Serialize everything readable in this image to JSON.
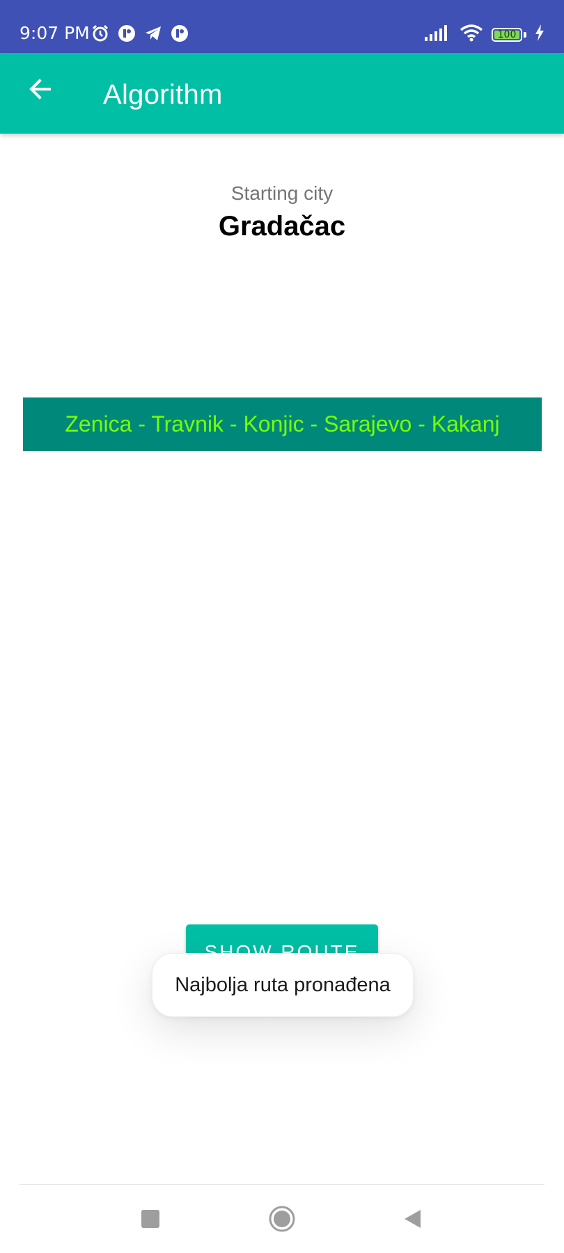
{
  "status_bar": {
    "time": "9:07 PM",
    "battery_level": "100",
    "icons_left": [
      "alarm-icon",
      "notification-app-icon",
      "telegram-icon",
      "notification-app-icon"
    ],
    "icons_right": [
      "signal-icon",
      "wifi-icon",
      "battery-icon",
      "charging-icon"
    ]
  },
  "app_bar": {
    "title": "Algorithm",
    "back_icon": "arrow-back-icon",
    "color": "#00bfa5"
  },
  "main": {
    "starting_label": "Starting city",
    "starting_city": "Gradačac",
    "route": "Zenica - Travnik - Konjic - Sarajevo - Kakanj",
    "route_bg_color": "#00897b",
    "route_text_color": "#76ff03",
    "show_route_label": "SHOW ROUTE"
  },
  "toast": {
    "message": "Najbolja ruta pronađena"
  },
  "nav_bar": {
    "buttons": [
      "recents-square-icon",
      "home-circle-icon",
      "back-triangle-icon"
    ]
  },
  "colors": {
    "status_bar": "#3f51b5",
    "accent": "#00bfa5"
  }
}
